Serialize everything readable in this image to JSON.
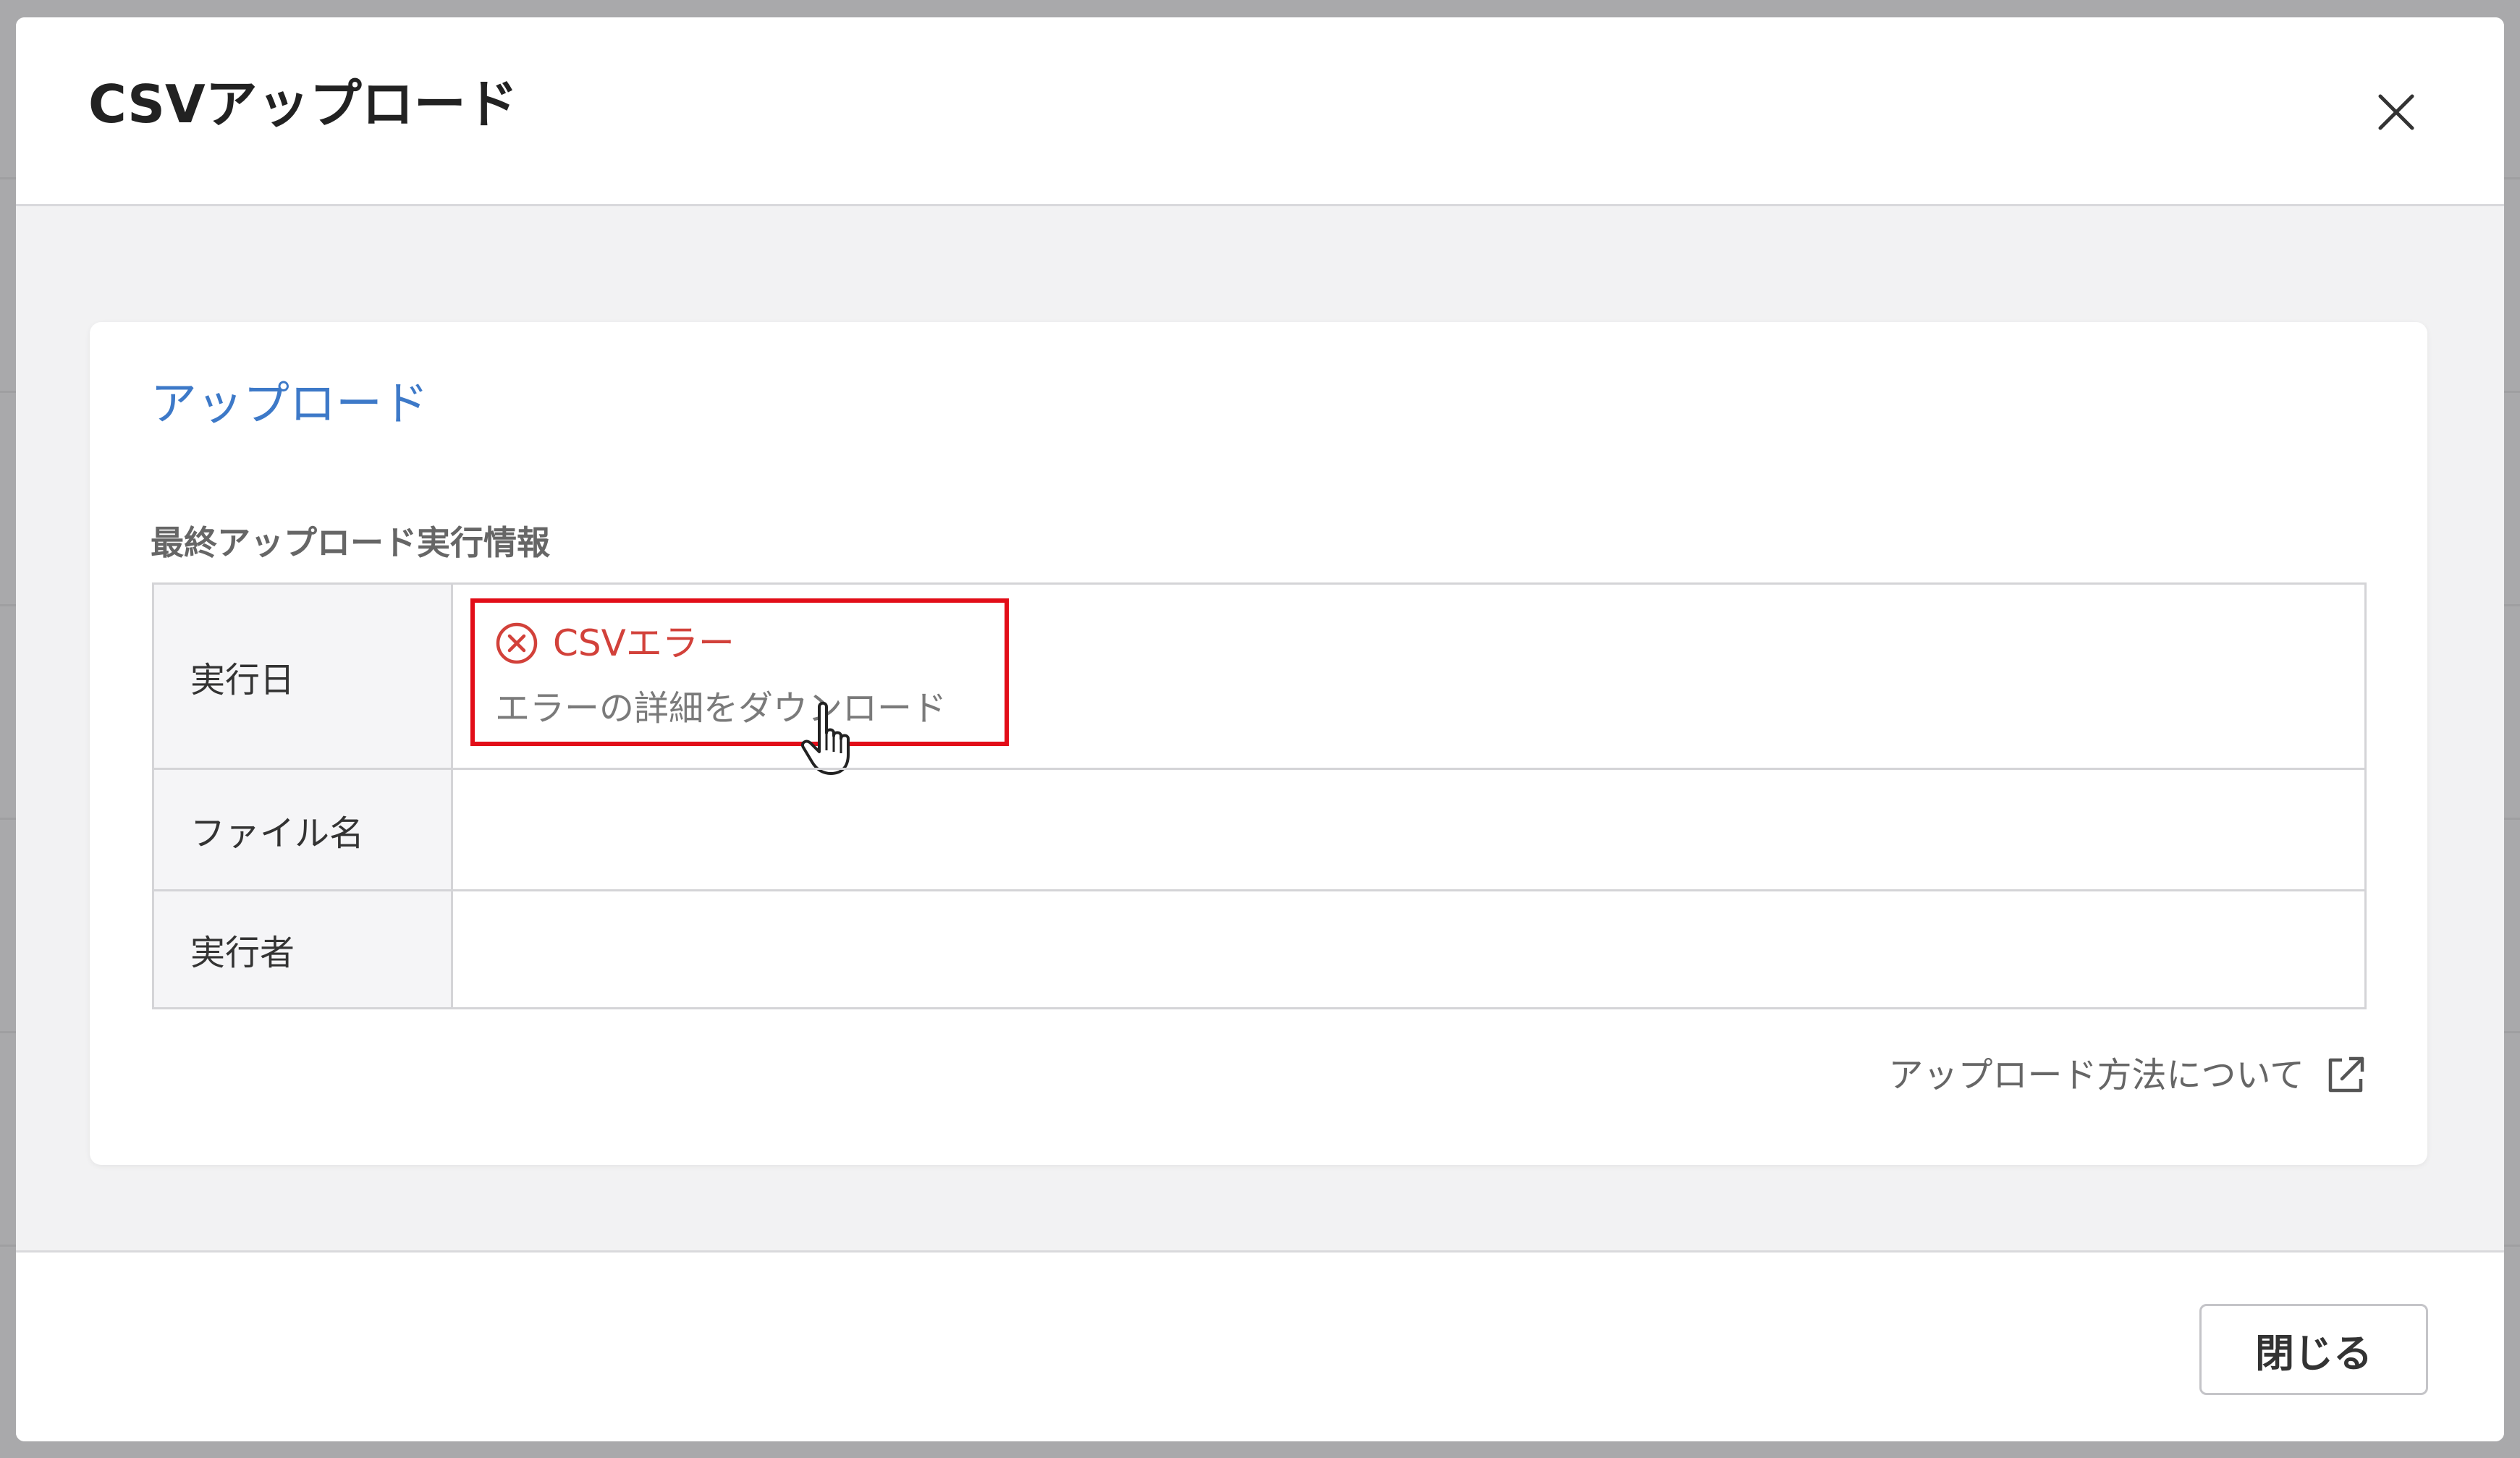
{
  "modal": {
    "title": "CSVアップロード",
    "close_icon": "close-icon"
  },
  "card": {
    "title": "アップロード",
    "section_label": "最終アップロード実行情報",
    "rows": [
      {
        "label": "実行日",
        "value": ""
      },
      {
        "label": "ファイル名",
        "value": ""
      },
      {
        "label": "実行者",
        "value": ""
      }
    ],
    "status": {
      "icon": "error-circle-x-icon",
      "text": "CSVエラー",
      "link": "エラーの詳細をダウンロード"
    },
    "help_link": {
      "text": "アップロード方法について",
      "icon": "external-link-icon"
    }
  },
  "footer": {
    "close_label": "閉じる"
  },
  "colors": {
    "accent_blue": "#3d79c8",
    "error_red": "#d2413a",
    "highlight_red": "#e20d18"
  }
}
